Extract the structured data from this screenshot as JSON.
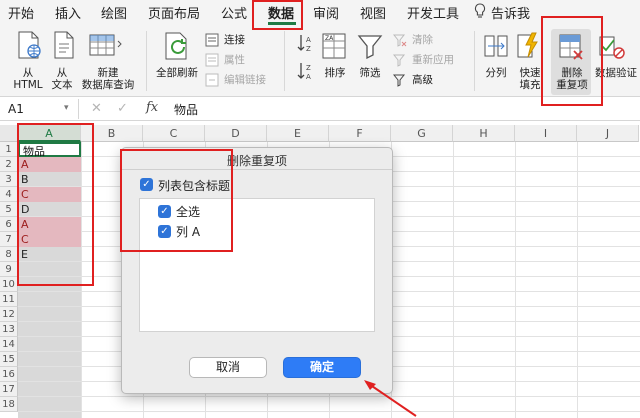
{
  "menu": {
    "tabs": [
      "开始",
      "插入",
      "绘图",
      "页面布局",
      "公式",
      "数据",
      "审阅",
      "视图",
      "开发工具"
    ],
    "active_tab": "数据",
    "tell_me": "告诉我"
  },
  "ribbon": {
    "from_html": "从\nHTML",
    "from_text": "从\n文本",
    "new_db_query": "新建\n数据库查询",
    "refresh_all": "全部刷新",
    "connections": "连接",
    "properties": "属性",
    "edit_links": "编辑链接",
    "sort": "排序",
    "filter": "筛选",
    "clear": "清除",
    "reapply": "重新应用",
    "advanced": "高级",
    "split": "分列",
    "flash_fill": "快速\n填充",
    "remove_duplicates": "删除\n重复项",
    "data_validation": "数据验证"
  },
  "formula_bar": {
    "cell_ref": "A1",
    "fx": "fx",
    "content": "物品"
  },
  "grid": {
    "columns": [
      "A",
      "B",
      "C",
      "D",
      "E",
      "F",
      "G",
      "H",
      "I",
      "J"
    ],
    "rows": [
      "1",
      "2",
      "3",
      "4",
      "5",
      "6",
      "7",
      "8",
      "9",
      "10",
      "11",
      "12",
      "13",
      "14",
      "15",
      "16",
      "17",
      "18"
    ],
    "column_a_values": [
      "物品",
      "A",
      "B",
      "C",
      "D",
      "A",
      "C",
      "E"
    ],
    "duplicate_flags": [
      false,
      true,
      false,
      true,
      false,
      true,
      true,
      false
    ]
  },
  "dialog": {
    "title": "删除重复项",
    "header_checkbox_label": "列表包含标题",
    "select_all_label": "全选",
    "column_a_label": "列 A",
    "cancel_label": "取消",
    "ok_label": "确定"
  },
  "colors": {
    "accent_green": "#1f7a44",
    "duplicate_fill": "#e4b8bf",
    "duplicate_text": "#9c1c1c",
    "dialog_button_blue": "#2e7cf6",
    "annotation_red": "#e02020"
  }
}
